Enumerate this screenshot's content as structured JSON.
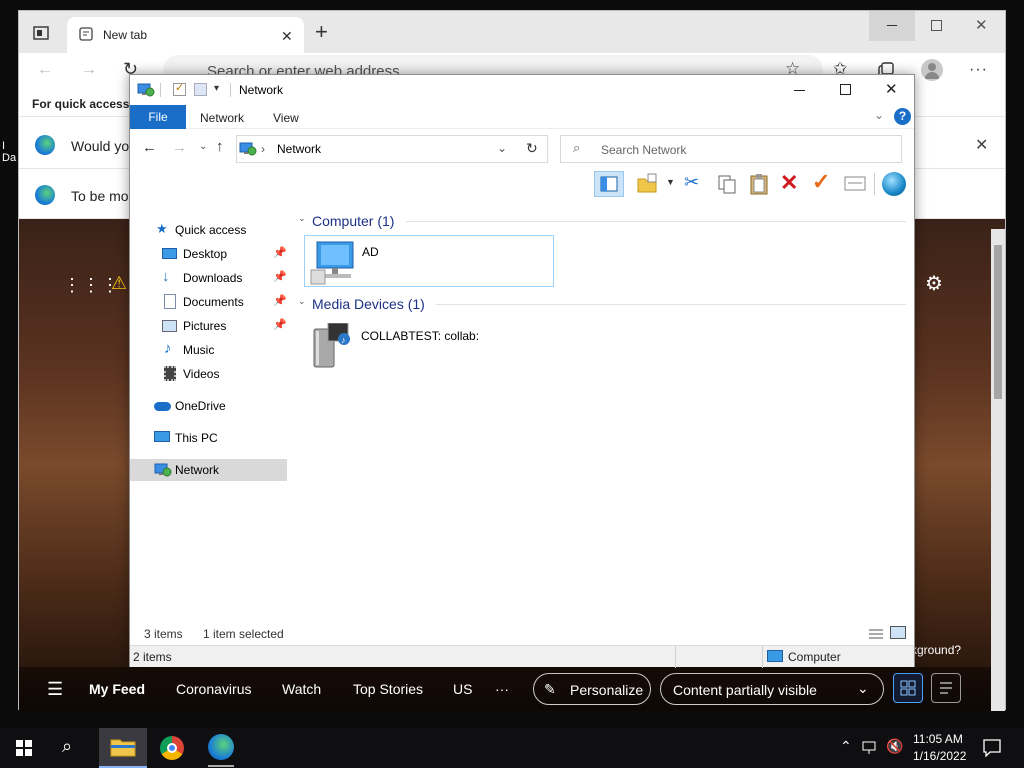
{
  "edge": {
    "tab_title": "New tab",
    "address_placeholder": "Search or enter web address",
    "favbar_text": "For quick access, p",
    "info1_text": "Would you",
    "info2_text": "To be mos",
    "nav_items": [
      "My Feed",
      "Coronavirus",
      "Watch",
      "Top Stories",
      "US",
      "···"
    ],
    "personalize_label": "Personalize",
    "content_visible_label": "Content partially visible",
    "background_hint": "ckground?"
  },
  "explorer": {
    "window_title": "Network",
    "ribbon_tabs": [
      "File",
      "Network",
      "View"
    ],
    "address_path": "Network",
    "search_placeholder": "Search Network",
    "nav": {
      "quick_access": "Quick access",
      "desktop": "Desktop",
      "downloads": "Downloads",
      "documents": "Documents",
      "pictures": "Pictures",
      "music": "Music",
      "videos": "Videos",
      "onedrive": "OneDrive",
      "this_pc": "This PC",
      "network": "Network"
    },
    "groups": [
      {
        "title": "Computer (1)",
        "items": [
          "AD"
        ]
      },
      {
        "title": "Media Devices (1)",
        "items": [
          "COLLABTEST: collab:"
        ]
      }
    ],
    "status_items": "3 items",
    "status_selected": "1 item selected",
    "status2_items": "2 items",
    "status2_zone": "Computer"
  },
  "taskbar": {
    "time": "11:05 AM",
    "date": "1/16/2022"
  },
  "colors": {
    "accent": "#1a6ec7",
    "group_header": "#1e3287",
    "selection_border": "#99d1ff"
  }
}
